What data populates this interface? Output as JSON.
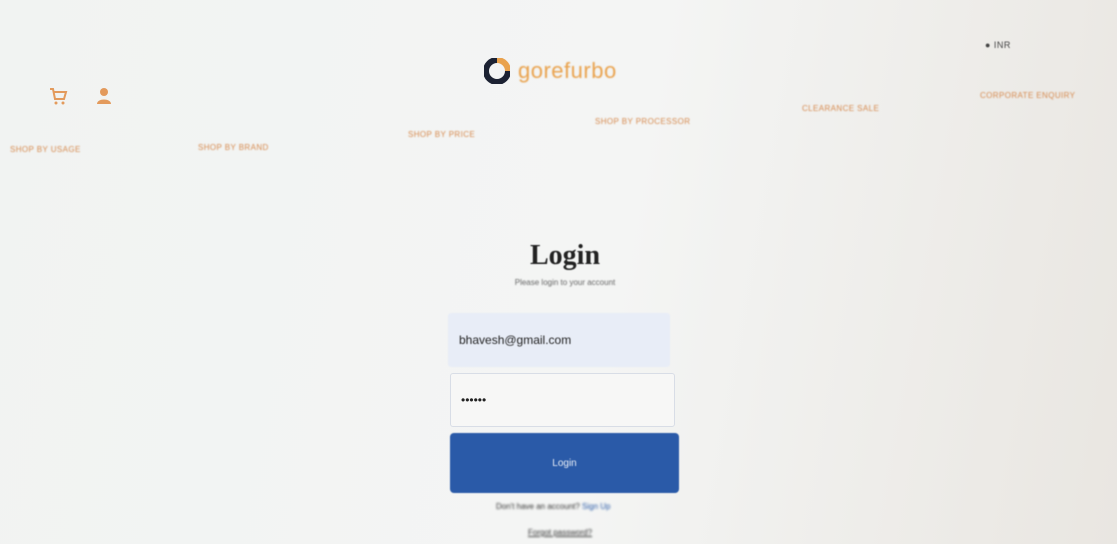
{
  "header": {
    "currency_label": "● INR",
    "brand_name": "gorefurbo",
    "icons": {
      "cart": "cart-icon",
      "account": "user-icon"
    }
  },
  "nav": {
    "items": [
      {
        "label": "Shop by Usage"
      },
      {
        "label": "Shop by Brand"
      },
      {
        "label": "Shop by Price"
      },
      {
        "label": "Shop by Processor"
      },
      {
        "label": "Clearance Sale"
      },
      {
        "label": "Corporate Enquiry"
      }
    ]
  },
  "login": {
    "title": "Login",
    "subtitle": "Please login to your account",
    "email_value": "bhavesh@gmail.com",
    "password_value": "••••••",
    "button_label": "Login",
    "signup_prefix": "Don't have an account?",
    "signup_link": "Sign Up",
    "forgot_link": "Forgot password?"
  },
  "colors": {
    "accent": "#e9a24d",
    "nav_text": "#d6894d",
    "button": "#2a5aa8"
  }
}
